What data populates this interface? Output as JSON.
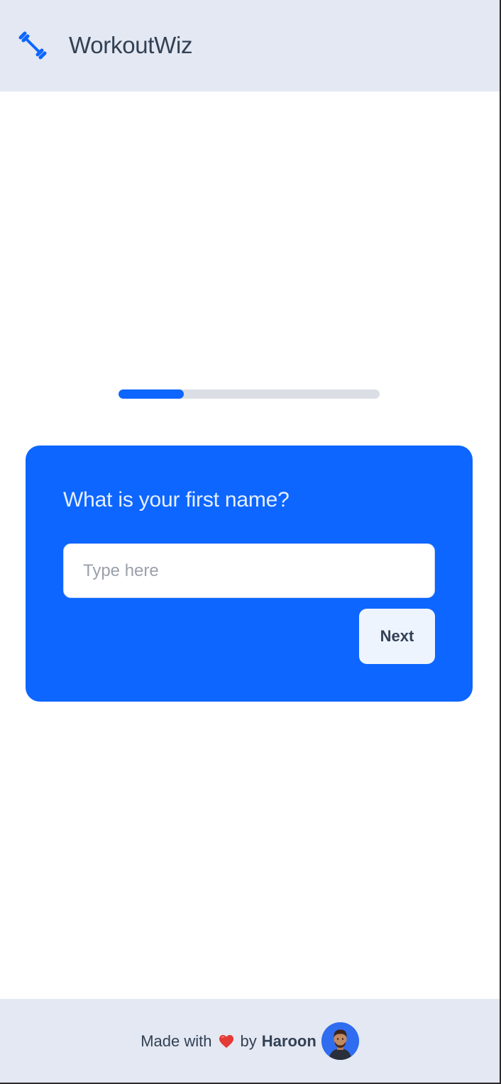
{
  "header": {
    "app_title": "WorkoutWiz",
    "logo_icon": "dumbbell-icon"
  },
  "progress": {
    "fraction": 0.25
  },
  "question_card": {
    "question": "What is your first name?",
    "input": {
      "value": "",
      "placeholder": "Type here"
    },
    "next_label": "Next"
  },
  "footer": {
    "made_with": "Made with",
    "heart_icon": "heart-icon",
    "by": "by",
    "author": "Haroon",
    "avatar_icon": "avatar"
  },
  "colors": {
    "accent": "#0d66ff",
    "header_bg": "#e3e8f2",
    "text_dark": "#334155",
    "progress_track": "#dbdee4",
    "heart": "#e53935"
  }
}
